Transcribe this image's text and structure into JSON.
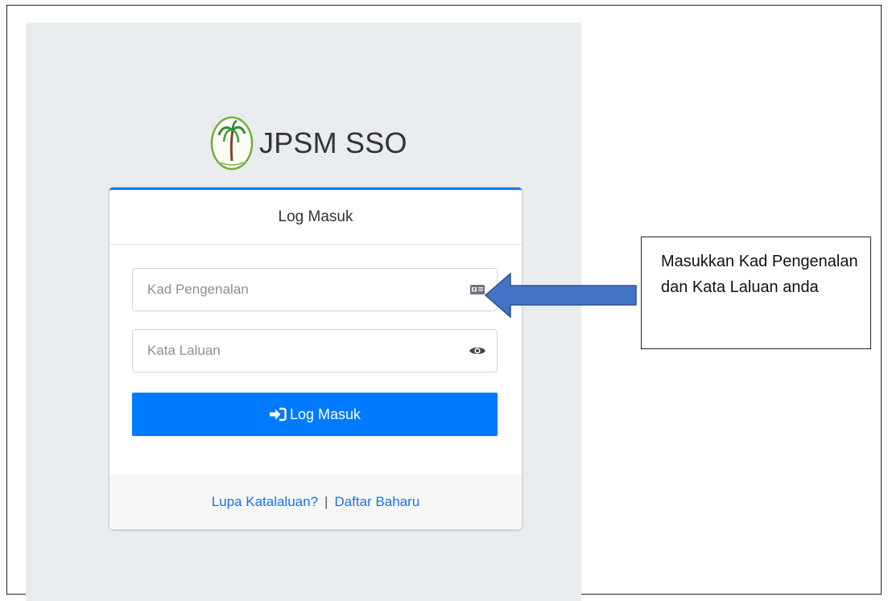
{
  "brand": {
    "name_bold": "JPSM",
    "name_rest": " SSO"
  },
  "card": {
    "header_title": "Log Masuk",
    "ic_field": {
      "placeholder": "Kad Pengenalan",
      "value": "",
      "icon": "id-card-icon"
    },
    "password_field": {
      "placeholder": "Kata Laluan",
      "value": "",
      "icon": "eye-icon"
    },
    "login_button": {
      "label": "Log Masuk",
      "icon": "sign-in-icon"
    },
    "footer": {
      "forgot_link": "Lupa Katalaluan?",
      "separator": "|",
      "register_link": "Daftar Baharu"
    }
  },
  "annotation": {
    "callout_text": "Masukkan Kad Pengenalan dan Kata Laluan anda",
    "arrow_color": "#4472c4"
  },
  "colors": {
    "primary": "#007bff",
    "panel_bg": "#e9ecef",
    "link": "#1a73e8"
  }
}
